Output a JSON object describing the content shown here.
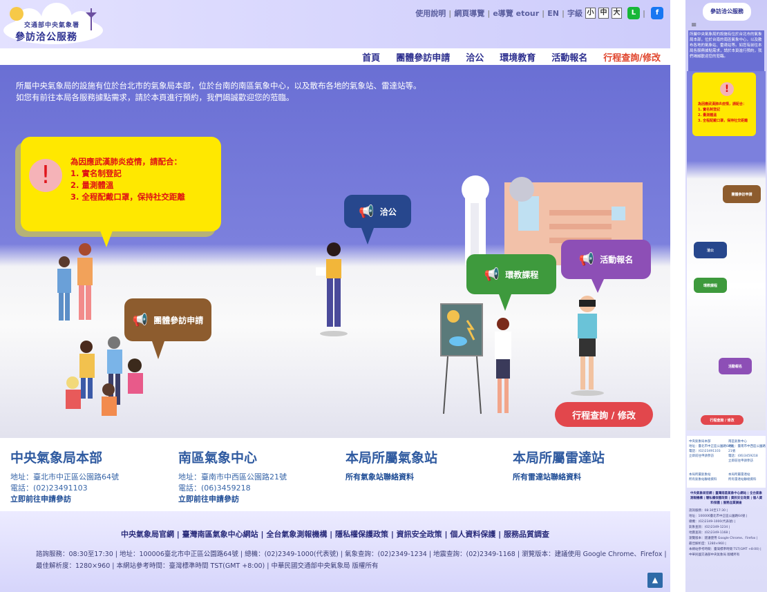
{
  "logo": {
    "line1": "交通部中央氣象署",
    "line2": "參訪洽公服務"
  },
  "util": {
    "links": [
      "使用說明",
      "網頁導覽",
      "e導覽 etour",
      "EN"
    ],
    "font_label": "字級",
    "font_sizes": [
      "小",
      "中",
      "大"
    ],
    "line_icon": "line-icon",
    "facebook_icon": "facebook-icon"
  },
  "nav": {
    "items": [
      "首頁",
      "團體參訪申請",
      "洽公",
      "環境教育",
      "活動報名",
      "行程查詢/修改"
    ],
    "active_index": 5,
    "active_color": "#e0452d"
  },
  "hero": {
    "intro_line1": "所屬中央氣象局的設施有位於台北市的氣象局本部，位於台南的南區氣象中心，以及散布各地的氣象站、雷達站等。",
    "intro_line2": "如您有前往本局各服務據點需求，請於本頁進行預約，我們竭誠歡迎您的蒞臨。",
    "notice": {
      "title": "為因應武漢肺炎疫情，請配合：",
      "items": [
        "1. 實名制登記",
        "2. 量測體溫",
        "3. 全程配戴口罩，保持社交距離"
      ],
      "icon": "exclamation-icon"
    },
    "bubbles": {
      "group": "團體參訪申請",
      "visit": "洽公",
      "env": "環教課程",
      "activity": "活動報名",
      "query": "行程查詢 / 修改"
    },
    "colors": {
      "group": "#8d5c2e",
      "visit": "#27478d",
      "env": "#3e9a3d",
      "activity": "#8d4fb6",
      "query": "#e2474c",
      "notice": "#ffe800"
    }
  },
  "info": [
    {
      "title": "中央氣象局本部",
      "address": "地址：臺北市中正區公園路64號",
      "phone": "電話：(02)23491103",
      "link": "立即前往申請參訪"
    },
    {
      "title": "南區氣象中心",
      "address": "地址：臺南市中西區公園路21號",
      "phone": "電話：(06)3459218",
      "link": "立即前往申請參訪"
    },
    {
      "title": "本局所屬氣象站",
      "link": "所有氣象站聯絡資料"
    },
    {
      "title": "本局所屬雷達站",
      "link": "所有雷達站聯絡資料"
    }
  ],
  "footer": {
    "links": "中央氣象局官網 | 臺灣南區氣象中心網站 | 全台氣象測報機構 | 隱私權保護政策 | 資訊安全政策 | 個人資料保護 | 服務品質調查",
    "line1": "諮詢服務：08:30至17:30 | 地址：100006臺北市中正區公園路64號 | 總機：(02)2349-1000(代表號) | 氣象查詢：(02)2349-1234 | 地震查詢：(02)2349-1168 | 瀏覽版本：建議使用 Google Chrome、Firefox |",
    "line2": "最佳解析度：1280×960 | 本網站參考時間：臺灣標準時間 TST(GMT +8:00) | 中華民國交通部中央氣象局 版權所有",
    "top_icon": "arrow-up-icon"
  },
  "mobile": {
    "logo": "參訪洽公服務",
    "menu_icon": "hamburger-icon",
    "intro": "所屬中央氣象局的設施有位於台北市的氣象局本部，位於台南的南區氣象中心，以及散布各地的氣象站、雷達站等。如您有前往本局各服務據點需求，請於本頁進行預約，我們竭誠歡迎您的蒞臨。",
    "notice_title": "為因應武漢肺炎疫情，請配合：",
    "notice_items": [
      "1. 實名制登記",
      "2. 量測體溫",
      "3. 全程配戴口罩，保持社交距離"
    ],
    "b_group": "團體參訪申請",
    "b_visit": "洽公",
    "b_env": "環教課程",
    "b_act": "活動報名",
    "b_query": "行程查詢 / 修改",
    "info1_title": "中央氣象局本部",
    "info1_addr": "地址：臺北市中正區公園路64號",
    "info1_phone": "電話：(02)23491103",
    "info1_link": "立即前往申請參訪",
    "info2_title": "南區氣象中心",
    "info2_addr": "地址：臺南市中西區公園路21號",
    "info2_phone": "電話：(06)3459218",
    "info2_link": "立即前往申請參訪",
    "info3_title": "本局所屬氣象站",
    "info3_link": "所有氣象站聯絡資料",
    "info4_title": "本局所屬雷達站",
    "info4_link": "所有雷達站聯絡資料",
    "foot_links": "中央氣象局官網 | 臺灣南區氣象中心網站 | 全台氣象測報機構 | 隱私權保護政策 | 資訊安全政策 | 個人資料保護 | 服務品質調查",
    "foot_lines": [
      "諮詢服務：08:30至17:30 |",
      "地址：100006臺北市中正區公園路64號 |",
      "總機：(02)2349-1000(代表號) |",
      "氣象查詢：(02)2349-1234 |",
      "地震查詢：(02)2349-1168 |",
      "瀏覽版本：建議使用 Google Chrome、Firefox |",
      "最佳解析度：1280×960 |",
      "本網站參考時間：臺灣標準時間 TST(GMT +8:00) |",
      "中華民國交通部中央氣象局 版權所有"
    ]
  }
}
